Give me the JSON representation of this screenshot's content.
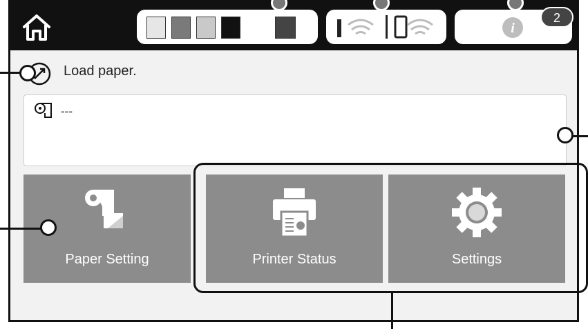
{
  "header": {
    "home_icon": "home-icon",
    "ink_levels": [
      {
        "name": "light-gray",
        "color": "#e6e6e6"
      },
      {
        "name": "gray",
        "color": "#7a7a7a"
      },
      {
        "name": "light",
        "color": "#c9c9c9"
      },
      {
        "name": "black",
        "color": "#111111"
      },
      {
        "name": "dark-gray",
        "color": "#444444"
      }
    ],
    "network_icons": [
      "wifi-icon",
      "wifi-direct-icon"
    ],
    "info_icon": "info-icon",
    "notification_count": "2"
  },
  "status": {
    "icon": "paper-feed-icon",
    "message": "Load paper."
  },
  "paper_info": {
    "icon": "roll-paper-icon",
    "value": "---"
  },
  "tiles": [
    {
      "name": "paper-setting",
      "label": "Paper Setting",
      "icon": "paper-setting-icon"
    },
    {
      "name": "printer-status",
      "label": "Printer Status",
      "icon": "printer-icon"
    },
    {
      "name": "settings",
      "label": "Settings",
      "icon": "gear-icon"
    }
  ]
}
